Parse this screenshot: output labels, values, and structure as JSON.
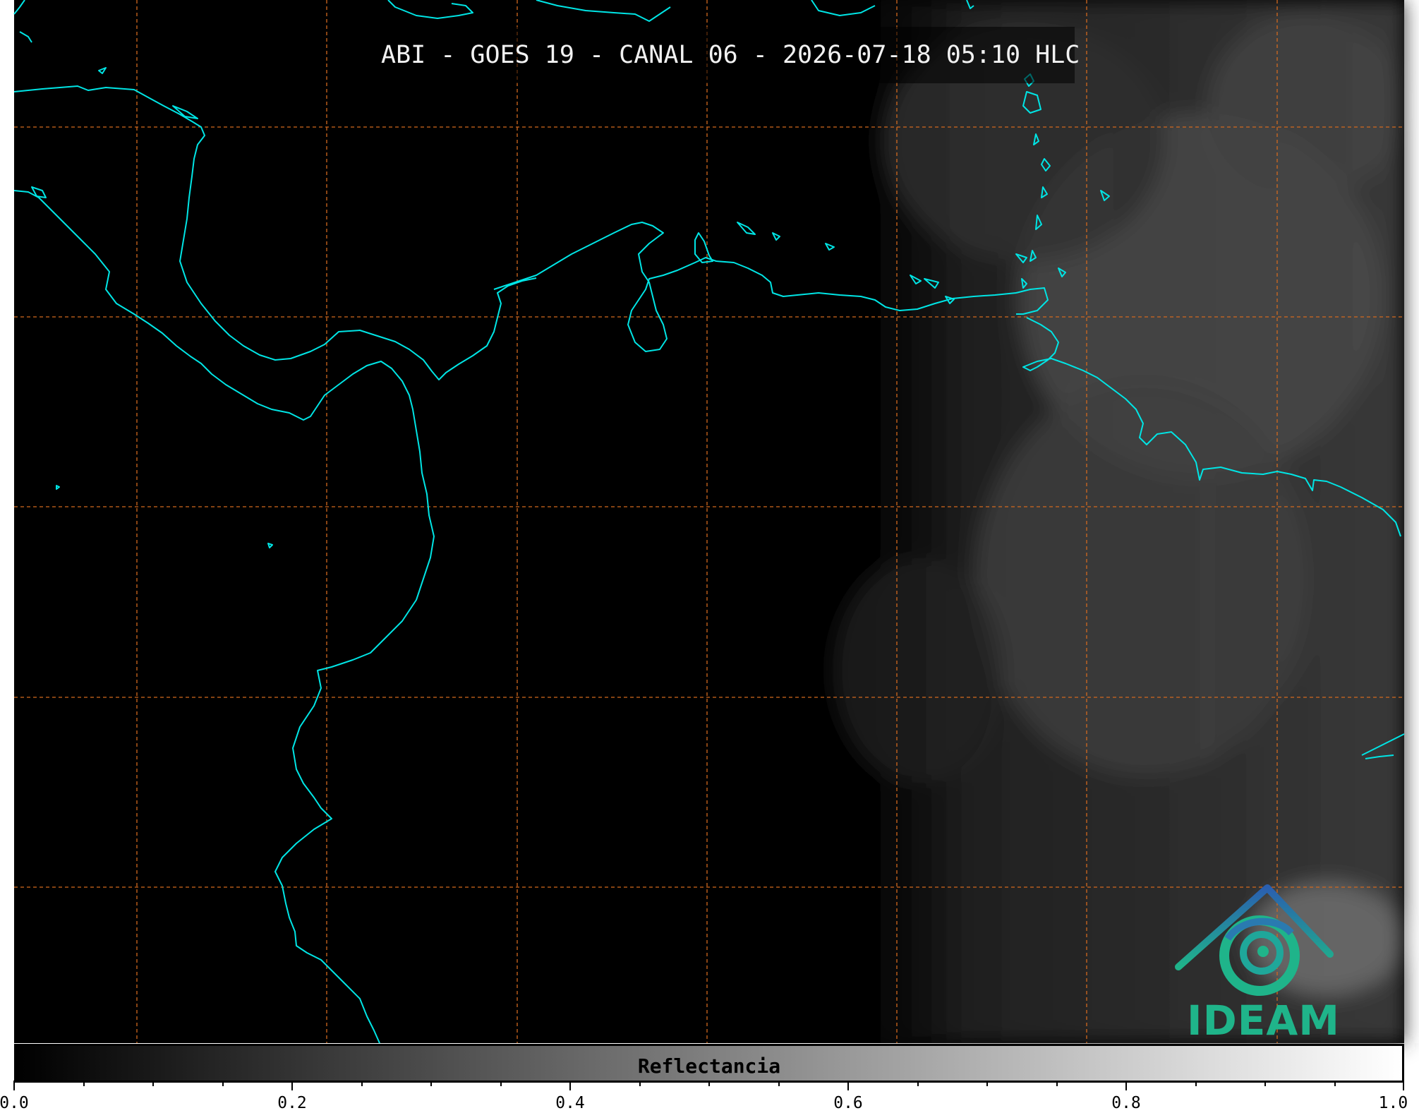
{
  "title": "ABI - GOES 19 - CANAL 06 - 2026-07-18 05:10 HLC",
  "colorbar": {
    "label": "Reflectancia",
    "ticks": [
      "0.0",
      "0.2",
      "0.4",
      "0.6",
      "0.8",
      "1.0"
    ],
    "range": [
      0.0,
      1.0
    ],
    "colormap": [
      "#000000",
      "#ffffff"
    ]
  },
  "logo": {
    "text": "IDEAM"
  },
  "colors": {
    "coastline": "#00e5e5",
    "grid": "#d2691e",
    "background": "#000000",
    "logo_text": "#1fb48a"
  },
  "map": {
    "gridlines": "dashed",
    "coastlines": true
  }
}
